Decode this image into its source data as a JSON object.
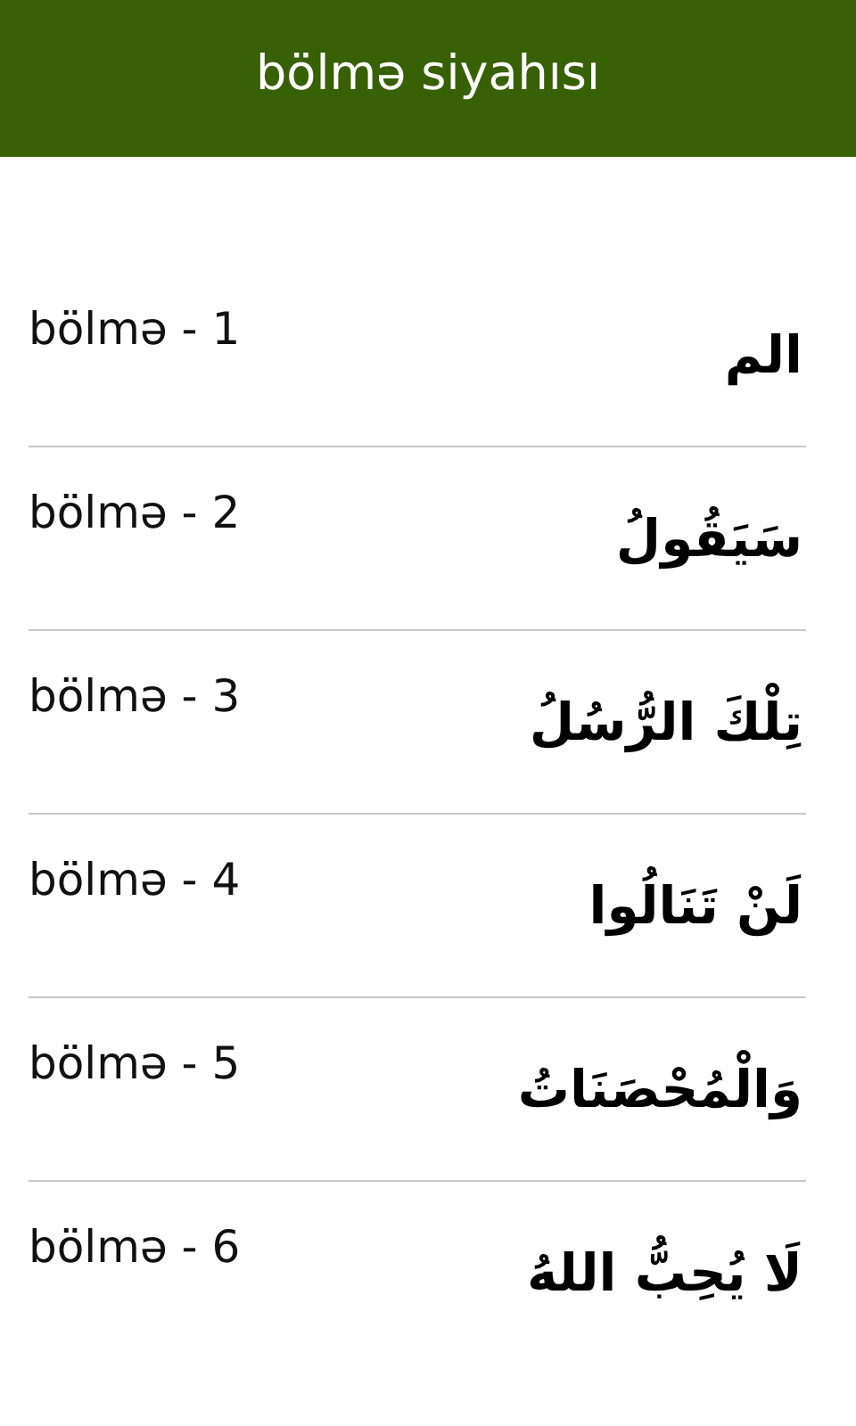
{
  "header": {
    "title": "bölmə siyahısı"
  },
  "sections": [
    {
      "label": "bölmə - 1",
      "arabic": "الم"
    },
    {
      "label": "bölmə - 2",
      "arabic": "سَيَقُولُ"
    },
    {
      "label": "bölmə - 3",
      "arabic": "تِلْكَ الرُّسُلُ"
    },
    {
      "label": "bölmə - 4",
      "arabic": "لَنْ تَنَالُوا"
    },
    {
      "label": "bölmə - 5",
      "arabic": "وَالْمُحْصَنَاتُ"
    },
    {
      "label": "bölmə - 6",
      "arabic": "لَا يُحِبُّ اللهُ"
    }
  ]
}
